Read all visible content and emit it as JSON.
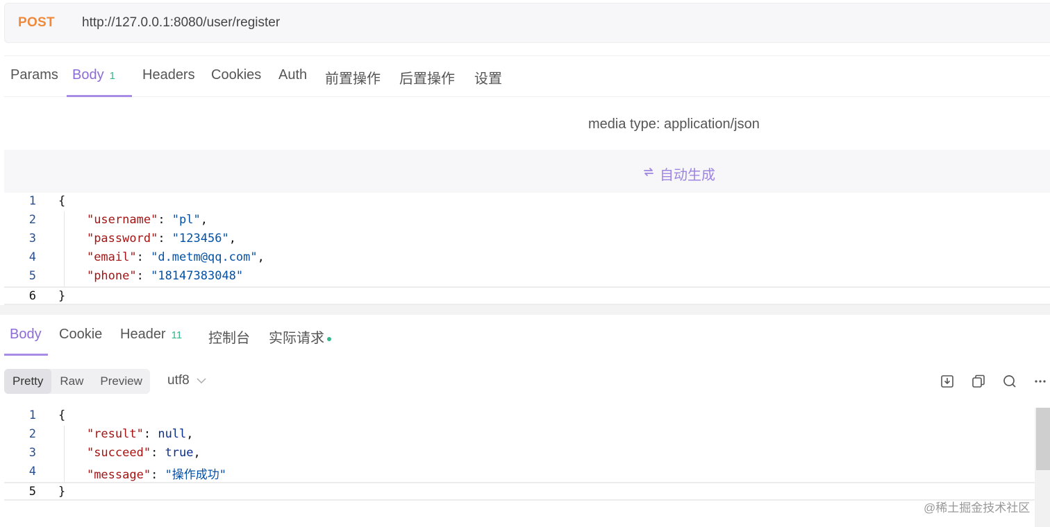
{
  "request": {
    "method": "POST",
    "url": "http://127.0.0.1:8080/user/register"
  },
  "request_tabs": [
    {
      "label": "Params"
    },
    {
      "label": "Body",
      "count": "1"
    },
    {
      "label": "Headers"
    },
    {
      "label": "Cookies"
    },
    {
      "label": "Auth"
    },
    {
      "label": "前置操作"
    },
    {
      "label": "后置操作"
    },
    {
      "label": "设置"
    }
  ],
  "media_type": "media type: application/json",
  "auto_generate_label": "自动生成",
  "request_body_lines": [
    {
      "n": "1",
      "text": "{"
    },
    {
      "n": "2",
      "key": "\"username\"",
      "value": "\"pl\"",
      "trail": ","
    },
    {
      "n": "3",
      "key": "\"password\"",
      "value": "\"123456\"",
      "trail": ","
    },
    {
      "n": "4",
      "key": "\"email\"",
      "value": "\"d.metm@qq.com\"",
      "trail": ","
    },
    {
      "n": "5",
      "key": "\"phone\"",
      "value": "\"18147383048\"",
      "trail": ""
    },
    {
      "n": "6",
      "text": "}"
    }
  ],
  "response_tabs": [
    {
      "label": "Body"
    },
    {
      "label": "Cookie"
    },
    {
      "label": "Header",
      "count": "11"
    },
    {
      "label": "控制台"
    },
    {
      "label": "实际请求"
    }
  ],
  "format_options": [
    "Pretty",
    "Raw",
    "Preview"
  ],
  "encoding": "utf8",
  "response_body_lines": [
    {
      "n": "1",
      "text": "{"
    },
    {
      "n": "2",
      "key": "\"result\"",
      "value": "null",
      "trail": ","
    },
    {
      "n": "3",
      "key": "\"succeed\"",
      "value": "true",
      "trail": ","
    },
    {
      "n": "4",
      "key": "\"message\"",
      "value": "\"操作成功\"",
      "trail": ""
    },
    {
      "n": "5",
      "text": "}"
    }
  ],
  "watermark": "@稀土掘金技术社区",
  "colors": {
    "method": "#f08a3a",
    "accent": "#8c6bd6",
    "count_badge": "#33b88a"
  }
}
